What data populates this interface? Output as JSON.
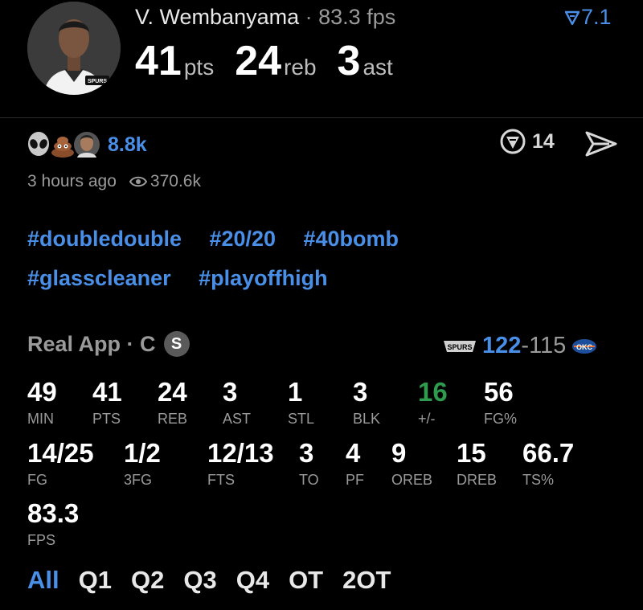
{
  "header": {
    "player_name": "V. Wembanyama",
    "separator": "·",
    "fps": "83.3 fps",
    "score": "7.1",
    "stats": [
      {
        "value": "41",
        "unit": "pts"
      },
      {
        "value": "24",
        "unit": "reb"
      },
      {
        "value": "3",
        "unit": "ast"
      }
    ],
    "jersey_logo": "SPURS"
  },
  "engagement": {
    "reactions": [
      "alien-emoji",
      "poop-emoji",
      "user-face"
    ],
    "reaction_count": "8.8k",
    "comment_count": "14",
    "posted": "3 hours ago",
    "views": "370.6k"
  },
  "hashtags": [
    "#doubledouble",
    "#20/20",
    "#40bomb",
    "#glasscleaner",
    "#playoffhigh"
  ],
  "game": {
    "source": "Real App",
    "separator": "·",
    "position": "C",
    "badge": "S",
    "team_logo": "SPURS",
    "team_score": "122",
    "dash": "-",
    "opp_score": "115",
    "opp_logo": "OKC"
  },
  "box_score": {
    "row1": [
      {
        "value": "49",
        "label": "MIN"
      },
      {
        "value": "41",
        "label": "PTS"
      },
      {
        "value": "24",
        "label": "REB"
      },
      {
        "value": "3",
        "label": "AST"
      },
      {
        "value": "1",
        "label": "STL"
      },
      {
        "value": "3",
        "label": "BLK"
      },
      {
        "value": "16",
        "label": "+/-"
      },
      {
        "value": "56",
        "label": "FG%"
      }
    ],
    "row2": [
      {
        "value": "14/25",
        "label": "FG"
      },
      {
        "value": "1/2",
        "label": "3FG"
      },
      {
        "value": "12/13",
        "label": "FTS"
      },
      {
        "value": "3",
        "label": "TO"
      },
      {
        "value": "4",
        "label": "PF"
      },
      {
        "value": "9",
        "label": "OREB"
      },
      {
        "value": "15",
        "label": "DREB"
      },
      {
        "value": "66.7",
        "label": "TS%"
      }
    ],
    "row3": [
      {
        "value": "83.3",
        "label": "FPS"
      }
    ]
  },
  "periods": [
    "All",
    "Q1",
    "Q2",
    "Q3",
    "Q4",
    "OT",
    "2OT"
  ],
  "colors": {
    "accent": "#4a8fe7",
    "positive": "#2e9b4e",
    "muted": "#9a9a9a",
    "background": "#000000"
  }
}
